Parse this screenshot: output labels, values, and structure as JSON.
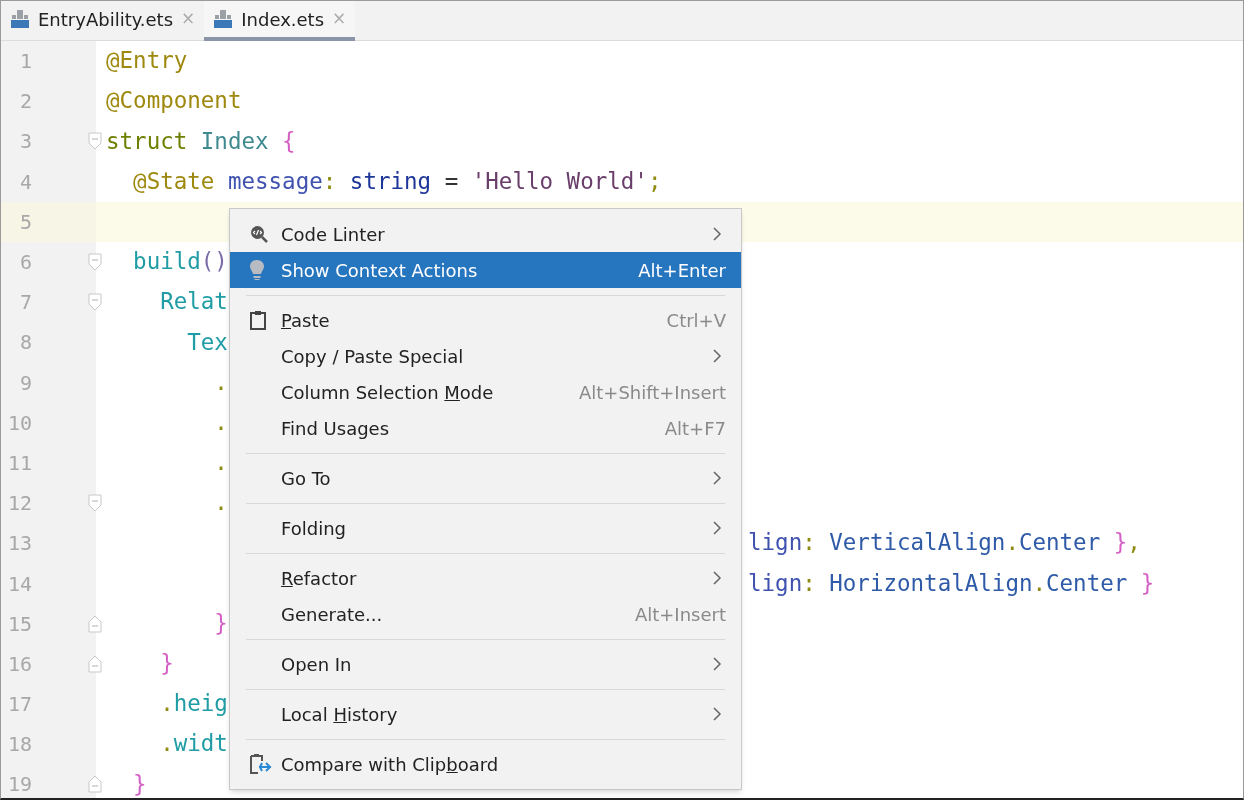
{
  "tabs": [
    {
      "label": "EntryAbility.ets",
      "close": "×",
      "selected": false
    },
    {
      "label": "Index.ets",
      "close": "×",
      "selected": true
    }
  ],
  "editor": {
    "lines": [
      {
        "number": "1",
        "current": false,
        "fold_start": false,
        "fold_end": false,
        "tokens": [
          {
            "text": "@Entry",
            "kind": "annotation"
          }
        ]
      },
      {
        "number": "2",
        "current": false,
        "fold_start": false,
        "fold_end": false,
        "tokens": [
          {
            "text": "@Component",
            "kind": "annotation"
          }
        ]
      },
      {
        "number": "3",
        "current": false,
        "fold_start": true,
        "fold_end": false,
        "tokens": [
          {
            "text": "struct",
            "kind": "keyword"
          },
          {
            "text": " Index",
            "kind": "type"
          },
          {
            "text": " {",
            "kind": "brace"
          }
        ]
      },
      {
        "number": "4",
        "current": false,
        "fold_start": false,
        "fold_end": false,
        "tokens": [
          {
            "text": "  @State",
            "kind": "annotation"
          },
          {
            "text": " message",
            "kind": "field"
          },
          {
            "text": ":",
            "kind": "punct"
          },
          {
            "text": " string",
            "kind": "typekw"
          },
          {
            "text": " =",
            "kind": "plain"
          },
          {
            "text": " 'Hello World'",
            "kind": "string"
          },
          {
            "text": ";",
            "kind": "punct"
          }
        ]
      },
      {
        "number": "5",
        "current": true,
        "fold_start": false,
        "fold_end": false
      },
      {
        "number": "6",
        "current": false,
        "fold_start": true,
        "fold_end": false,
        "tokens": [
          {
            "text": "  build",
            "kind": "method"
          },
          {
            "text": "()",
            "kind": "paren"
          }
        ]
      },
      {
        "number": "7",
        "current": false,
        "fold_start": true,
        "fold_end": false,
        "tokens": [
          {
            "text": "    Relat",
            "kind": "method"
          }
        ]
      },
      {
        "number": "8",
        "current": false,
        "fold_start": false,
        "fold_end": false,
        "tokens": [
          {
            "text": "      Tex",
            "kind": "method"
          }
        ]
      },
      {
        "number": "9",
        "current": false,
        "fold_start": false,
        "fold_end": false,
        "tokens": [
          {
            "text": "        .",
            "kind": "punct"
          }
        ]
      },
      {
        "number": "10",
        "current": false,
        "fold_start": false,
        "fold_end": false,
        "tokens": [
          {
            "text": "        .",
            "kind": "punct"
          }
        ]
      },
      {
        "number": "11",
        "current": false,
        "fold_start": false,
        "fold_end": false,
        "tokens": [
          {
            "text": "        .",
            "kind": "punct"
          }
        ]
      },
      {
        "number": "12",
        "current": false,
        "fold_start": true,
        "fold_end": false,
        "tokens": [
          {
            "text": "        .",
            "kind": "punct"
          }
        ]
      },
      {
        "number": "13",
        "current": false,
        "fold_start": false,
        "fold_end": false,
        "after_menu": [
          {
            "text": "lign",
            "kind": "field"
          },
          {
            "text": ":",
            "kind": "punct"
          },
          {
            "text": " VerticalAlign",
            "kind": "enum"
          },
          {
            "text": ".",
            "kind": "punct"
          },
          {
            "text": "Center",
            "kind": "enum"
          },
          {
            "text": " }",
            "kind": "brace"
          },
          {
            "text": ",",
            "kind": "punct"
          }
        ]
      },
      {
        "number": "14",
        "current": false,
        "fold_start": false,
        "fold_end": false,
        "after_menu": [
          {
            "text": "lign",
            "kind": "field"
          },
          {
            "text": ":",
            "kind": "punct"
          },
          {
            "text": " HorizontalAlign",
            "kind": "enum"
          },
          {
            "text": ".",
            "kind": "punct"
          },
          {
            "text": "Center",
            "kind": "enum"
          },
          {
            "text": " }",
            "kind": "brace"
          }
        ]
      },
      {
        "number": "15",
        "current": false,
        "fold_start": false,
        "fold_end": true,
        "tokens": [
          {
            "text": "        }",
            "kind": "brace"
          }
        ]
      },
      {
        "number": "16",
        "current": false,
        "fold_start": false,
        "fold_end": true,
        "tokens": [
          {
            "text": "    }",
            "kind": "brace"
          }
        ]
      },
      {
        "number": "17",
        "current": false,
        "fold_start": false,
        "fold_end": false,
        "tokens": [
          {
            "text": "    .",
            "kind": "punct"
          },
          {
            "text": "heig",
            "kind": "method"
          }
        ]
      },
      {
        "number": "18",
        "current": false,
        "fold_start": false,
        "fold_end": false,
        "tokens": [
          {
            "text": "    .",
            "kind": "punct"
          },
          {
            "text": "widt",
            "kind": "method"
          }
        ]
      },
      {
        "number": "19",
        "current": false,
        "fold_start": false,
        "fold_end": true,
        "tokens": [
          {
            "text": "  }",
            "kind": "brace"
          }
        ]
      }
    ]
  },
  "context_menu": {
    "items": [
      {
        "kind": "item",
        "label": "Code Linter",
        "submenu": true,
        "selected": false
      },
      {
        "kind": "item",
        "label": "Show Context Actions",
        "shortcut": "Alt+Enter",
        "submenu": false,
        "selected": true
      },
      {
        "kind": "separator"
      },
      {
        "kind": "item",
        "label_parts": [
          {
            "text": "P",
            "underlined": true
          },
          {
            "text": "aste",
            "underlined": false
          }
        ],
        "shortcut": "Ctrl+V",
        "submenu": false,
        "selected": false
      },
      {
        "kind": "item",
        "label": "Copy / Paste Special",
        "submenu": true,
        "selected": false
      },
      {
        "kind": "item",
        "label_parts": [
          {
            "text": "Column Selection ",
            "underlined": false
          },
          {
            "text": "M",
            "underlined": true
          },
          {
            "text": "ode",
            "underlined": false
          }
        ],
        "shortcut": "Alt+Shift+Insert",
        "submenu": false,
        "selected": false
      },
      {
        "kind": "item",
        "label": "Find Usages",
        "shortcut": "Alt+F7",
        "submenu": false,
        "selected": false
      },
      {
        "kind": "separator"
      },
      {
        "kind": "item",
        "label": "Go To",
        "submenu": true,
        "selected": false
      },
      {
        "kind": "separator"
      },
      {
        "kind": "item",
        "label": "Folding",
        "submenu": true,
        "selected": false
      },
      {
        "kind": "separator"
      },
      {
        "kind": "item",
        "label_parts": [
          {
            "text": "R",
            "underlined": true
          },
          {
            "text": "efactor",
            "underlined": false
          }
        ],
        "submenu": true,
        "selected": false
      },
      {
        "kind": "item",
        "label": "Generate...",
        "shortcut": "Alt+Insert",
        "submenu": false,
        "selected": false
      },
      {
        "kind": "separator"
      },
      {
        "kind": "item",
        "label": "Open In",
        "submenu": true,
        "selected": false
      },
      {
        "kind": "separator"
      },
      {
        "kind": "item",
        "label_parts": [
          {
            "text": "Local ",
            "underlined": false
          },
          {
            "text": "H",
            "underlined": true
          },
          {
            "text": "istory",
            "underlined": false
          }
        ],
        "submenu": true,
        "selected": false
      },
      {
        "kind": "separator"
      },
      {
        "kind": "item",
        "label_parts": [
          {
            "text": "Compare with Clip",
            "underlined": false
          },
          {
            "text": "b",
            "underlined": true
          },
          {
            "text": "oard",
            "underlined": false
          }
        ],
        "submenu": false,
        "selected": false
      }
    ]
  }
}
